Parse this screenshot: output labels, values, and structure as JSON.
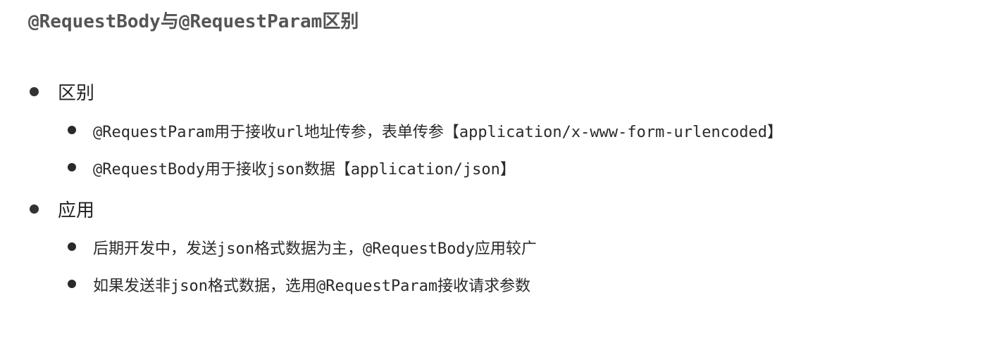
{
  "title": "@RequestBody与@RequestParam区别",
  "sections": [
    {
      "label": "区别",
      "items": [
        "@RequestParam用于接收url地址传参，表单传参【application/x-www-form-urlencoded】",
        "@RequestBody用于接收json数据【application/json】"
      ]
    },
    {
      "label": "应用",
      "items": [
        "后期开发中，发送json格式数据为主，@RequestBody应用较广",
        "如果发送非json格式数据，选用@RequestParam接收请求参数"
      ]
    }
  ]
}
